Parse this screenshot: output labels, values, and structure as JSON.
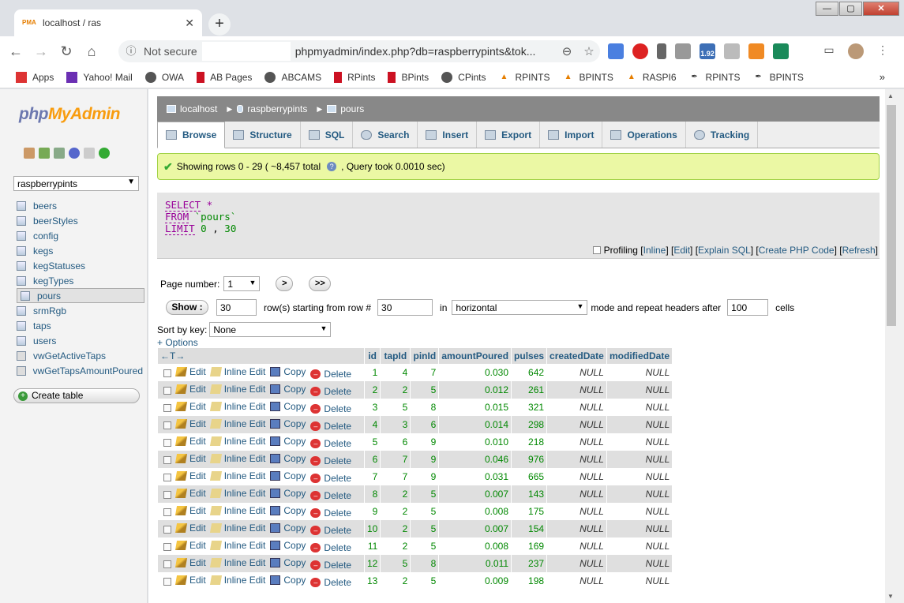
{
  "browser": {
    "tab_title": "localhost / ras",
    "not_secure": "Not secure",
    "url": "phpmyadmin/index.php?db=raspberrypints&tok...",
    "bookmarks": [
      "Apps",
      "Yahoo! Mail",
      "OWA",
      "AB Pages",
      "ABCAMS",
      "RPints",
      "BPints",
      "CPints",
      "RPINTS",
      "BPINTS",
      "RASPI6",
      "RPINTS",
      "BPINTS"
    ],
    "more": "»",
    "ext_badge": "1.92"
  },
  "sidebar": {
    "logo_a": "php",
    "logo_b": "MyAdmin",
    "db_selected": "raspberrypints",
    "tables": [
      "beers",
      "beerStyles",
      "config",
      "kegs",
      "kegStatuses",
      "kegTypes",
      "pours",
      "srmRgb",
      "taps",
      "users",
      "vwGetActiveTaps",
      "vwGetTapsAmountPoured"
    ],
    "selected_table": "pours",
    "create_table": "Create table"
  },
  "breadcrumb": [
    "localhost",
    "raspberrypints",
    "pours"
  ],
  "tabs": [
    "Browse",
    "Structure",
    "SQL",
    "Search",
    "Insert",
    "Export",
    "Import",
    "Operations",
    "Tracking"
  ],
  "success": {
    "text": "Showing rows 0 - 29 ( ~8,457 total",
    "text2": ", Query took 0.0010 sec)"
  },
  "sql": {
    "select": "SELECT",
    "star": " *",
    "from": "FROM",
    "table": " `pours`",
    "limit": "LIMIT",
    "lim_a": " 0",
    "comma": " ,",
    "lim_b": " 30"
  },
  "sql_links": {
    "profiling": "Profiling",
    "inline": "Inline",
    "edit": "Edit",
    "explain": "Explain SQL",
    "create_php": "Create PHP Code",
    "refresh": "Refresh"
  },
  "navigation": {
    "page_number_label": "Page number:",
    "page_number": "1",
    "next": ">",
    "last": ">>",
    "show_btn": "Show :",
    "rows_value": "30",
    "rows_label": "row(s) starting from row #",
    "start_row": "30",
    "in_label": "in",
    "mode": "horizontal",
    "mode_label": "mode and repeat headers after",
    "repeat_value": "100",
    "cells_label": "cells",
    "sort_label": "Sort by key:",
    "sort_value": "None",
    "options": "+ Options"
  },
  "table": {
    "arrows": "←T→",
    "columns": [
      "id",
      "tapId",
      "pinId",
      "amountPoured",
      "pulses",
      "createdDate",
      "modifiedDate"
    ],
    "actions": [
      "Edit",
      "Inline Edit",
      "Copy",
      "Delete"
    ],
    "rows": [
      [
        "1",
        "4",
        "7",
        "0.030",
        "642",
        "NULL",
        "NULL"
      ],
      [
        "2",
        "2",
        "5",
        "0.012",
        "261",
        "NULL",
        "NULL"
      ],
      [
        "3",
        "5",
        "8",
        "0.015",
        "321",
        "NULL",
        "NULL"
      ],
      [
        "4",
        "3",
        "6",
        "0.014",
        "298",
        "NULL",
        "NULL"
      ],
      [
        "5",
        "6",
        "9",
        "0.010",
        "218",
        "NULL",
        "NULL"
      ],
      [
        "6",
        "7",
        "9",
        "0.046",
        "976",
        "NULL",
        "NULL"
      ],
      [
        "7",
        "7",
        "9",
        "0.031",
        "665",
        "NULL",
        "NULL"
      ],
      [
        "8",
        "2",
        "5",
        "0.007",
        "143",
        "NULL",
        "NULL"
      ],
      [
        "9",
        "2",
        "5",
        "0.008",
        "175",
        "NULL",
        "NULL"
      ],
      [
        "10",
        "2",
        "5",
        "0.007",
        "154",
        "NULL",
        "NULL"
      ],
      [
        "11",
        "2",
        "5",
        "0.008",
        "169",
        "NULL",
        "NULL"
      ],
      [
        "12",
        "5",
        "8",
        "0.011",
        "237",
        "NULL",
        "NULL"
      ],
      [
        "13",
        "2",
        "5",
        "0.009",
        "198",
        "NULL",
        "NULL"
      ]
    ]
  }
}
